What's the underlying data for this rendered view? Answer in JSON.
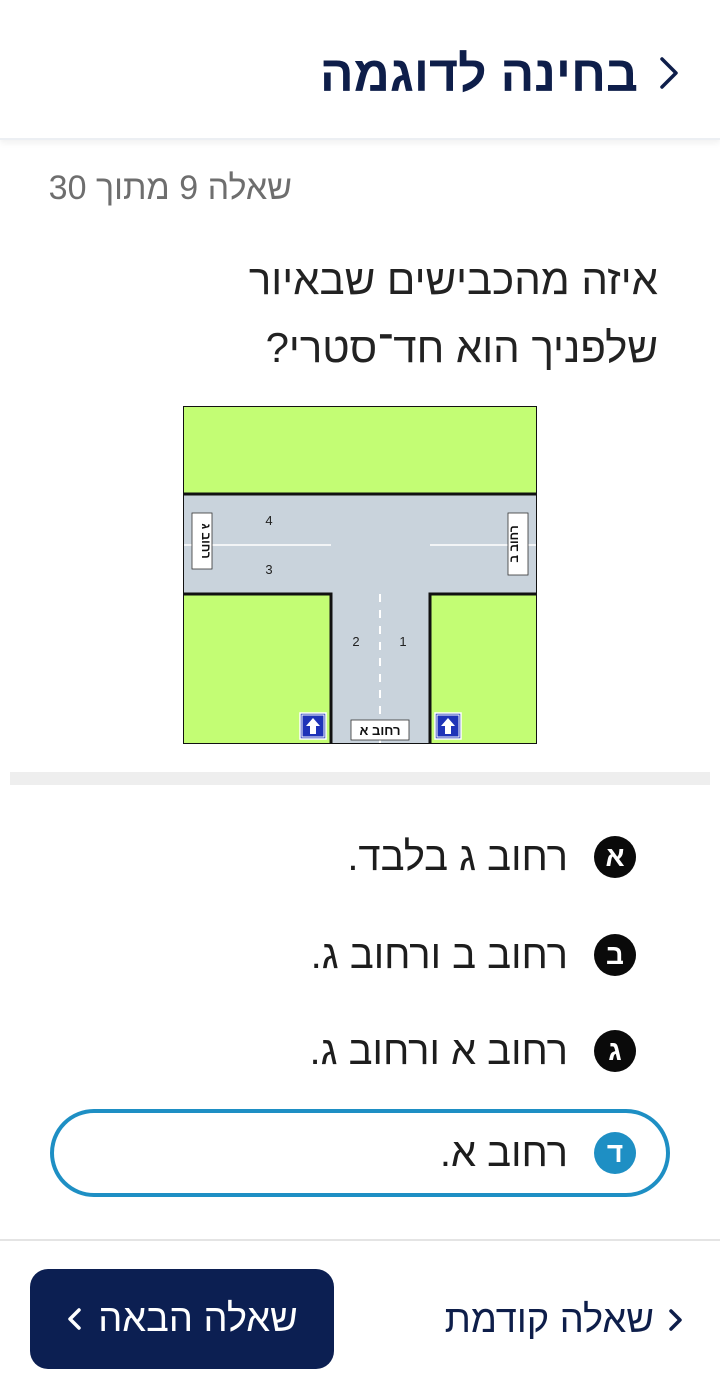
{
  "header": {
    "title": "בחינה לדוגמה",
    "back_icon": "chevron-right-icon"
  },
  "progress": {
    "counter_text": "שאלה 9 מתוך 30",
    "current": 9,
    "total": 30
  },
  "question": {
    "line1": "איזה מהכבישים שבאיור",
    "line2": "שלפניך הוא חד־סטרי?"
  },
  "diagram": {
    "labels": {
      "street_a": "רחוב א",
      "street_b": "רחוב ב",
      "street_c": "רחוב ג"
    },
    "lane_numbers": [
      "1",
      "2",
      "3",
      "4"
    ],
    "colors": {
      "grass": "#c3fd74",
      "road": "#c9d3dc",
      "sign_blue": "#1e33b8"
    },
    "sign_icon": "one-way-arrow-up-icon"
  },
  "answers": [
    {
      "letter": "א",
      "text": "רחוב ג בלבד.",
      "selected": false
    },
    {
      "letter": "ב",
      "text": "רחוב ב ורחוב ג.",
      "selected": false
    },
    {
      "letter": "ג",
      "text": "רחוב א  ורחוב ג.",
      "selected": false
    },
    {
      "letter": "ד",
      "text": "רחוב א.",
      "selected": true
    }
  ],
  "navigation": {
    "next_label": "שאלה הבאה",
    "prev_label": "שאלה קודמת"
  },
  "colors": {
    "primary": "#0c1f52",
    "accent": "#1e8fc4"
  }
}
